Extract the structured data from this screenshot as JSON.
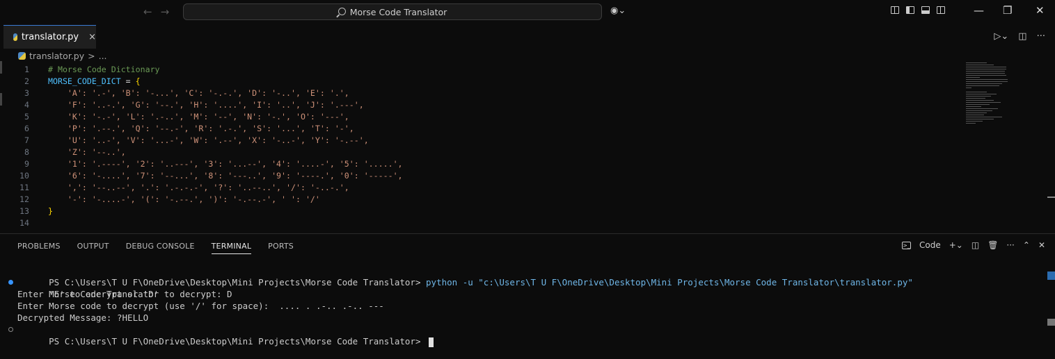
{
  "titlebar": {
    "search_text": "Morse Code Translator",
    "icons": [
      "arrow-left-icon",
      "arrow-right-icon",
      "search-icon",
      "copilot-icon",
      "layout-icons",
      "minimize-icon",
      "maximize-icon",
      "close-icon"
    ]
  },
  "editor": {
    "tab_label": "translator.py",
    "tab_close": "×",
    "breadcrumb_file": "translator.py",
    "breadcrumb_sep": ">",
    "breadcrumb_more": "...",
    "lines": [
      {
        "n": "1",
        "text": "# Morse Code Dictionary",
        "kind": "comment"
      },
      {
        "n": "2",
        "text": "MORSE_CODE_DICT = {",
        "kind": "decl"
      },
      {
        "n": "3",
        "text": "    'A': '.-', 'B': '-...', 'C': '-.-.', 'D': '-..', 'E': '.',",
        "kind": "str"
      },
      {
        "n": "4",
        "text": "    'F': '..-.', 'G': '--.', 'H': '....', 'I': '..', 'J': '.---',",
        "kind": "str"
      },
      {
        "n": "5",
        "text": "    'K': '-.-', 'L': '.-..', 'M': '--', 'N': '-.', 'O': '---',",
        "kind": "str"
      },
      {
        "n": "6",
        "text": "    'P': '.--.', 'Q': '--.-', 'R': '.-.', 'S': '...', 'T': '-',",
        "kind": "str"
      },
      {
        "n": "7",
        "text": "    'U': '..-', 'V': '...-', 'W': '.--', 'X': '-..-', 'Y': '-.--',",
        "kind": "str"
      },
      {
        "n": "8",
        "text": "    'Z': '--..',",
        "kind": "str"
      },
      {
        "n": "9",
        "text": "    '1': '.----', '2': '..---', '3': '...--', '4': '....-', '5': '.....',",
        "kind": "str"
      },
      {
        "n": "10",
        "text": "    '6': '-....', '7': '--...', '8': '---..', '9': '----.', '0': '-----',",
        "kind": "str"
      },
      {
        "n": "11",
        "text": "    ',': '--..--', '.': '.-.-.-', '?': '..--..', '/': '-..-.',",
        "kind": "str"
      },
      {
        "n": "12",
        "text": "    '-': '-....-', '(': '-.--.', ')': '-.--.-', ' ': '/'",
        "kind": "str"
      },
      {
        "n": "13",
        "text": "}",
        "kind": "brace"
      },
      {
        "n": "14",
        "text": "",
        "kind": "plain"
      }
    ],
    "colors": {
      "comment": "#6a9955",
      "variable": "#4fc1ff",
      "string": "#ce9178",
      "brace": "#ffd700"
    }
  },
  "panel": {
    "tabs": [
      "PROBLEMS",
      "OUTPUT",
      "DEBUG CONSOLE",
      "TERMINAL",
      "PORTS"
    ],
    "active_tab": "TERMINAL",
    "terminal_label": "Code",
    "terminal_icon": ">_"
  },
  "terminal": {
    "line1_prompt": "PS C:\\Users\\T U F\\OneDrive\\Desktop\\Mini Projects\\Morse Code Translator> ",
    "line1_cmd": "python",
    "line1_args": " -u \"c:\\Users\\T U F\\OneDrive\\Desktop\\Mini Projects\\Morse Code Translator\\translator.py\"",
    "line2": "Morse Code Translator",
    "line3": "Enter 'E' to encrypt or 'D' to decrypt: D",
    "line4": "Enter Morse code to decrypt (use '/' for space):  .... . .-.. .-.. ---",
    "line5": "Decrypted Message: ?HELLO",
    "line6_prompt": "PS C:\\Users\\T U F\\OneDrive\\Desktop\\Mini Projects\\Morse Code Translator> "
  }
}
